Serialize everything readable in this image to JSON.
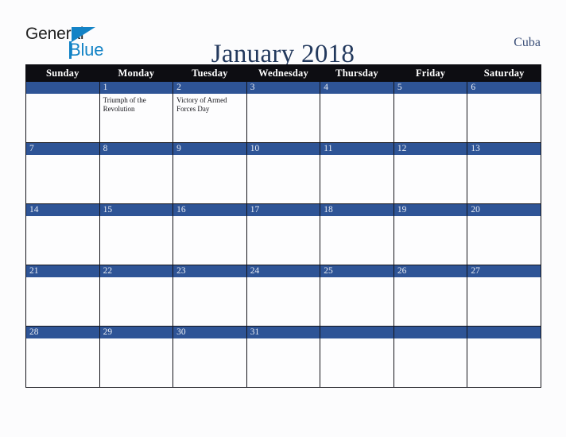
{
  "brand": {
    "name_part1": "General",
    "name_part2": "Blue",
    "accent_color": "#1383c6",
    "triangle_icon": "triangle-right-icon"
  },
  "header": {
    "title": "January 2018",
    "country": "Cuba",
    "title_color": "#23395d"
  },
  "calendar": {
    "month": "January",
    "year": "2018",
    "weekday_headers": [
      "Sunday",
      "Monday",
      "Tuesday",
      "Wednesday",
      "Thursday",
      "Friday",
      "Saturday"
    ],
    "header_bg": "#0d0d12",
    "date_bar_color": "#2e5496",
    "cell_bg": "#fdfdfe",
    "weeks": [
      [
        {
          "date": "",
          "blank": true,
          "events": []
        },
        {
          "date": "1",
          "blank": false,
          "events": [
            "Triumph of the Revolution"
          ]
        },
        {
          "date": "2",
          "blank": false,
          "events": [
            "Victory of Armed Forces Day"
          ]
        },
        {
          "date": "3",
          "blank": false,
          "events": []
        },
        {
          "date": "4",
          "blank": false,
          "events": []
        },
        {
          "date": "5",
          "blank": false,
          "events": []
        },
        {
          "date": "6",
          "blank": false,
          "events": []
        }
      ],
      [
        {
          "date": "7",
          "blank": false,
          "events": []
        },
        {
          "date": "8",
          "blank": false,
          "events": []
        },
        {
          "date": "9",
          "blank": false,
          "events": []
        },
        {
          "date": "10",
          "blank": false,
          "events": []
        },
        {
          "date": "11",
          "blank": false,
          "events": []
        },
        {
          "date": "12",
          "blank": false,
          "events": []
        },
        {
          "date": "13",
          "blank": false,
          "events": []
        }
      ],
      [
        {
          "date": "14",
          "blank": false,
          "events": []
        },
        {
          "date": "15",
          "blank": false,
          "events": []
        },
        {
          "date": "16",
          "blank": false,
          "events": []
        },
        {
          "date": "17",
          "blank": false,
          "events": []
        },
        {
          "date": "18",
          "blank": false,
          "events": []
        },
        {
          "date": "19",
          "blank": false,
          "events": []
        },
        {
          "date": "20",
          "blank": false,
          "events": []
        }
      ],
      [
        {
          "date": "21",
          "blank": false,
          "events": []
        },
        {
          "date": "22",
          "blank": false,
          "events": []
        },
        {
          "date": "23",
          "blank": false,
          "events": []
        },
        {
          "date": "24",
          "blank": false,
          "events": []
        },
        {
          "date": "25",
          "blank": false,
          "events": []
        },
        {
          "date": "26",
          "blank": false,
          "events": []
        },
        {
          "date": "27",
          "blank": false,
          "events": []
        }
      ],
      [
        {
          "date": "28",
          "blank": false,
          "events": []
        },
        {
          "date": "29",
          "blank": false,
          "events": []
        },
        {
          "date": "30",
          "blank": false,
          "events": []
        },
        {
          "date": "31",
          "blank": false,
          "events": []
        },
        {
          "date": "",
          "blank": true,
          "events": []
        },
        {
          "date": "",
          "blank": true,
          "events": []
        },
        {
          "date": "",
          "blank": true,
          "events": []
        }
      ]
    ]
  }
}
